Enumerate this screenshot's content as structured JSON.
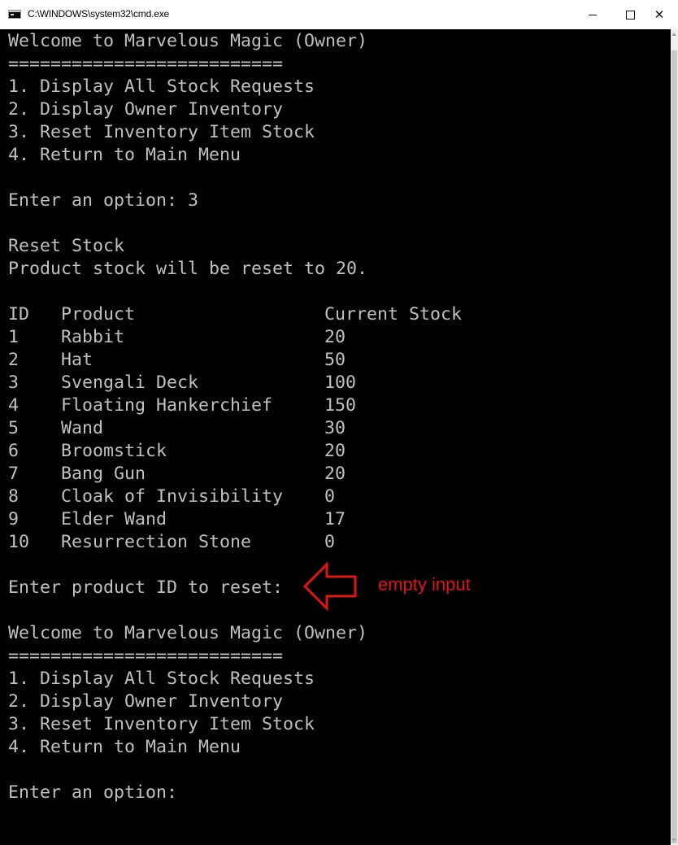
{
  "window": {
    "title": "C:\\WINDOWS\\system32\\cmd.exe",
    "controls": {
      "minimize": "",
      "maximize": "",
      "close": "✕"
    }
  },
  "console": {
    "block1": {
      "welcome": "Welcome to Marvelous Magic (Owner)",
      "separator": "==========================",
      "menu": [
        "1. Display All Stock Requests",
        "2. Display Owner Inventory",
        "3. Reset Inventory Item Stock",
        "4. Return to Main Menu"
      ],
      "prompt": "Enter an option: 3"
    },
    "reset_title": "Reset Stock",
    "reset_note": "Product stock will be reset to 20.",
    "table": {
      "headers": [
        "ID",
        "Product",
        "Current Stock"
      ],
      "rows": [
        [
          "1",
          "Rabbit",
          "20"
        ],
        [
          "2",
          "Hat",
          "50"
        ],
        [
          "3",
          "Svengali Deck",
          "100"
        ],
        [
          "4",
          "Floating Hankerchief",
          "150"
        ],
        [
          "5",
          "Wand",
          "30"
        ],
        [
          "6",
          "Broomstick",
          "20"
        ],
        [
          "7",
          "Bang Gun",
          "20"
        ],
        [
          "8",
          "Cloak of Invisibility",
          "0"
        ],
        [
          "9",
          "Elder Wand",
          "17"
        ],
        [
          "10",
          "Resurrection Stone",
          "0"
        ]
      ]
    },
    "reset_prompt": "Enter product ID to reset:",
    "block2": {
      "welcome": "Welcome to Marvelous Magic (Owner)",
      "separator": "==========================",
      "menu": [
        "1. Display All Stock Requests",
        "2. Display Owner Inventory",
        "3. Reset Inventory Item Stock",
        "4. Return to Main Menu"
      ],
      "prompt": "Enter an option:"
    }
  },
  "annotation": {
    "text": "empty input",
    "color": "#e01515",
    "icon": "left-arrow-outline-icon"
  },
  "colors": {
    "console_bg": "#000000",
    "console_text": "#c0c0c0"
  }
}
